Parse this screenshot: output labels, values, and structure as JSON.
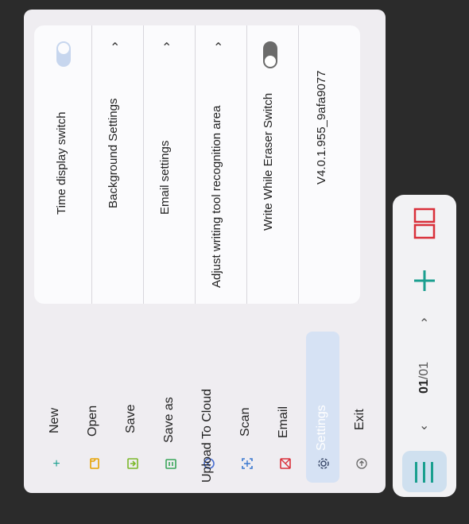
{
  "menu": {
    "items": [
      {
        "label": "New",
        "icon": "plus-icon"
      },
      {
        "label": "Open",
        "icon": "folder-icon"
      },
      {
        "label": "Save",
        "icon": "save-icon"
      },
      {
        "label": "Save as",
        "icon": "save-as-icon"
      },
      {
        "label": "Upload To Cloud",
        "icon": "cloud-upload-icon"
      },
      {
        "label": "Scan",
        "icon": "scan-icon"
      },
      {
        "label": "Email",
        "icon": "email-icon"
      },
      {
        "label": "Settings",
        "icon": "gear-icon",
        "selected": true
      },
      {
        "label": "Exit",
        "icon": "exit-icon"
      }
    ]
  },
  "settings": {
    "rows": [
      {
        "label": "Time display switch",
        "control": "toggle",
        "state": "on"
      },
      {
        "label": "Background Settings",
        "control": "expand"
      },
      {
        "label": "Email settings",
        "control": "expand"
      },
      {
        "label": "Adjust writing tool recognition area",
        "control": "expand"
      },
      {
        "label": "Write While Eraser Switch",
        "control": "toggle",
        "state": "off"
      }
    ],
    "version": "V4.0.1.955_9afa9077"
  },
  "toolbar": {
    "page_current": "01",
    "page_sep": "/",
    "page_total": "01"
  },
  "colors": {
    "accent": "#1a9f8f",
    "selected_bg": "#d6e2f4",
    "split_icon": "#d9303a"
  }
}
